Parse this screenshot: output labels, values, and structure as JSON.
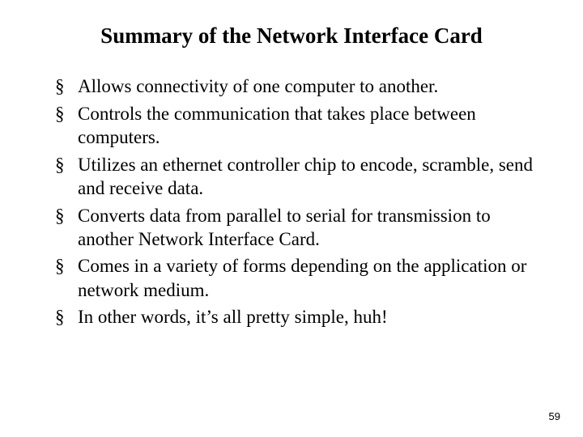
{
  "title": "Summary of the Network Interface Card",
  "bullets": [
    "Allows connectivity of one computer to another.",
    "Controls the communication that takes place between computers.",
    "Utilizes an ethernet controller chip to encode, scramble, send and receive data.",
    "Converts data from parallel to serial for transmission to another Network Interface Card.",
    "Comes in a variety of forms depending on the application or network medium.",
    "In other words, it’s all pretty simple, huh!"
  ],
  "page_number": "59"
}
